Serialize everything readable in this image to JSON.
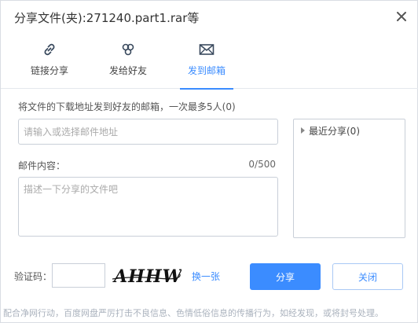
{
  "window": {
    "title": "分享文件(夹):271240.part1.rar等",
    "close_icon": "close-icon"
  },
  "tabs": [
    {
      "label": "链接分享",
      "icon": "link-icon",
      "active": false
    },
    {
      "label": "发给好友",
      "icon": "friends-icon",
      "active": false
    },
    {
      "label": "发到邮箱",
      "icon": "mail-icon",
      "active": true
    }
  ],
  "form": {
    "tip": "将文件的下载地址发到好友的邮箱，一次最多5人(0)",
    "email_placeholder": "请输入或选择邮件地址",
    "email_value": "",
    "recent_label": "最近分享(0)",
    "content_label": "邮件内容：",
    "counter": "0/500",
    "content_placeholder": "描述一下分享的文件吧",
    "content_value": ""
  },
  "captcha": {
    "label": "验证码：",
    "value": "",
    "image_text": "AHHW",
    "refresh_label": "换一张"
  },
  "buttons": {
    "share_label": "分享",
    "cancel_label": "关闭"
  },
  "notice": "配合净网行动，百度网盘严厉打击不良信息、色情低俗信息的传播行为，如经发现，或将封号处理。",
  "colors": {
    "accent": "#3b8cff",
    "border": "#c9cfd8",
    "notice_text": "#aab2bd"
  }
}
